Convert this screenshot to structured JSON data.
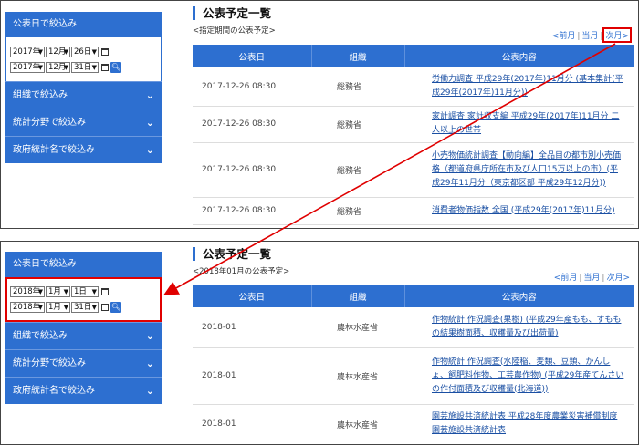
{
  "top": {
    "sidebar": {
      "filter_date_label": "公表日で絞込み",
      "from": {
        "year": "2017年",
        "month": "12月",
        "day": "26日"
      },
      "to": {
        "year": "2017年",
        "month": "12月",
        "day": "31日"
      },
      "items": [
        "組織で絞込み",
        "統計分野で絞込み",
        "政府統計名で絞込み"
      ]
    },
    "main": {
      "title": "公表予定一覧",
      "period": "<指定期間の公表予定>",
      "pager": {
        "prev": "<前月",
        "current": "当月",
        "next": "次月>"
      },
      "columns": [
        "公表日",
        "組織",
        "公表内容"
      ],
      "rows": [
        {
          "date": "2017-12-26 08:30",
          "org": "総務省",
          "content": "労働力調査  平成29年(2017年)11月分 (基本集計(平成29年(2017年)11月分))"
        },
        {
          "date": "2017-12-26 08:30",
          "org": "総務省",
          "content": "家計調査  家計収支編  平成29年(2017年)11月分  二人以上の世帯"
        },
        {
          "date": "2017-12-26 08:30",
          "org": "総務省",
          "content": "小売物価統計調査【動向編】全品目の都市別小売価格（都道府県庁所在市及び人口15万以上の市）(平成29年11月分（東京都区部  平成29年12月分))"
        },
        {
          "date": "2017-12-26 08:30",
          "org": "総務省",
          "content": "消費者物価指数  全国 (平成29年(2017年)11月分)"
        }
      ]
    }
  },
  "bottom": {
    "sidebar": {
      "filter_date_label": "公表日で絞込み",
      "from": {
        "year": "2018年",
        "month": "1月",
        "day": "1日"
      },
      "to": {
        "year": "2018年",
        "month": "1月",
        "day": "31日"
      },
      "items": [
        "組織で絞込み",
        "統計分野で絞込み",
        "政府統計名で絞込み"
      ]
    },
    "main": {
      "title": "公表予定一覧",
      "period": "<2018年01月の公表予定>",
      "pager": {
        "prev": "<前月",
        "current": "当月",
        "next": "次月>"
      },
      "columns": [
        "公表日",
        "組織",
        "公表内容"
      ],
      "rows": [
        {
          "date": "2018-01",
          "org": "農林水産省",
          "content": "作物統計  作況調査(果樹)  (平成29年産もも、すももの結果樹面積、収穫量及び出荷量)"
        },
        {
          "date": "2018-01",
          "org": "農林水産省",
          "content": "作物統計  作況調査(水陸稲、麦類、豆類、かんしょ、飼肥料作物、工芸農作物)  (平成29年産てんさいの作付面積及び収穫量(北海道))"
        },
        {
          "date": "2018-01",
          "org": "農林水産省",
          "content": "園芸施設共済統計表  平成28年度農業災害補償制度園芸施設共済統計表"
        }
      ]
    }
  },
  "colors": {
    "accent": "#2d6fd0",
    "highlight": "#e00000",
    "link": "#1a4fa3"
  },
  "icons": [
    "calendar-icon",
    "search-icon",
    "chevron-down-icon"
  ]
}
